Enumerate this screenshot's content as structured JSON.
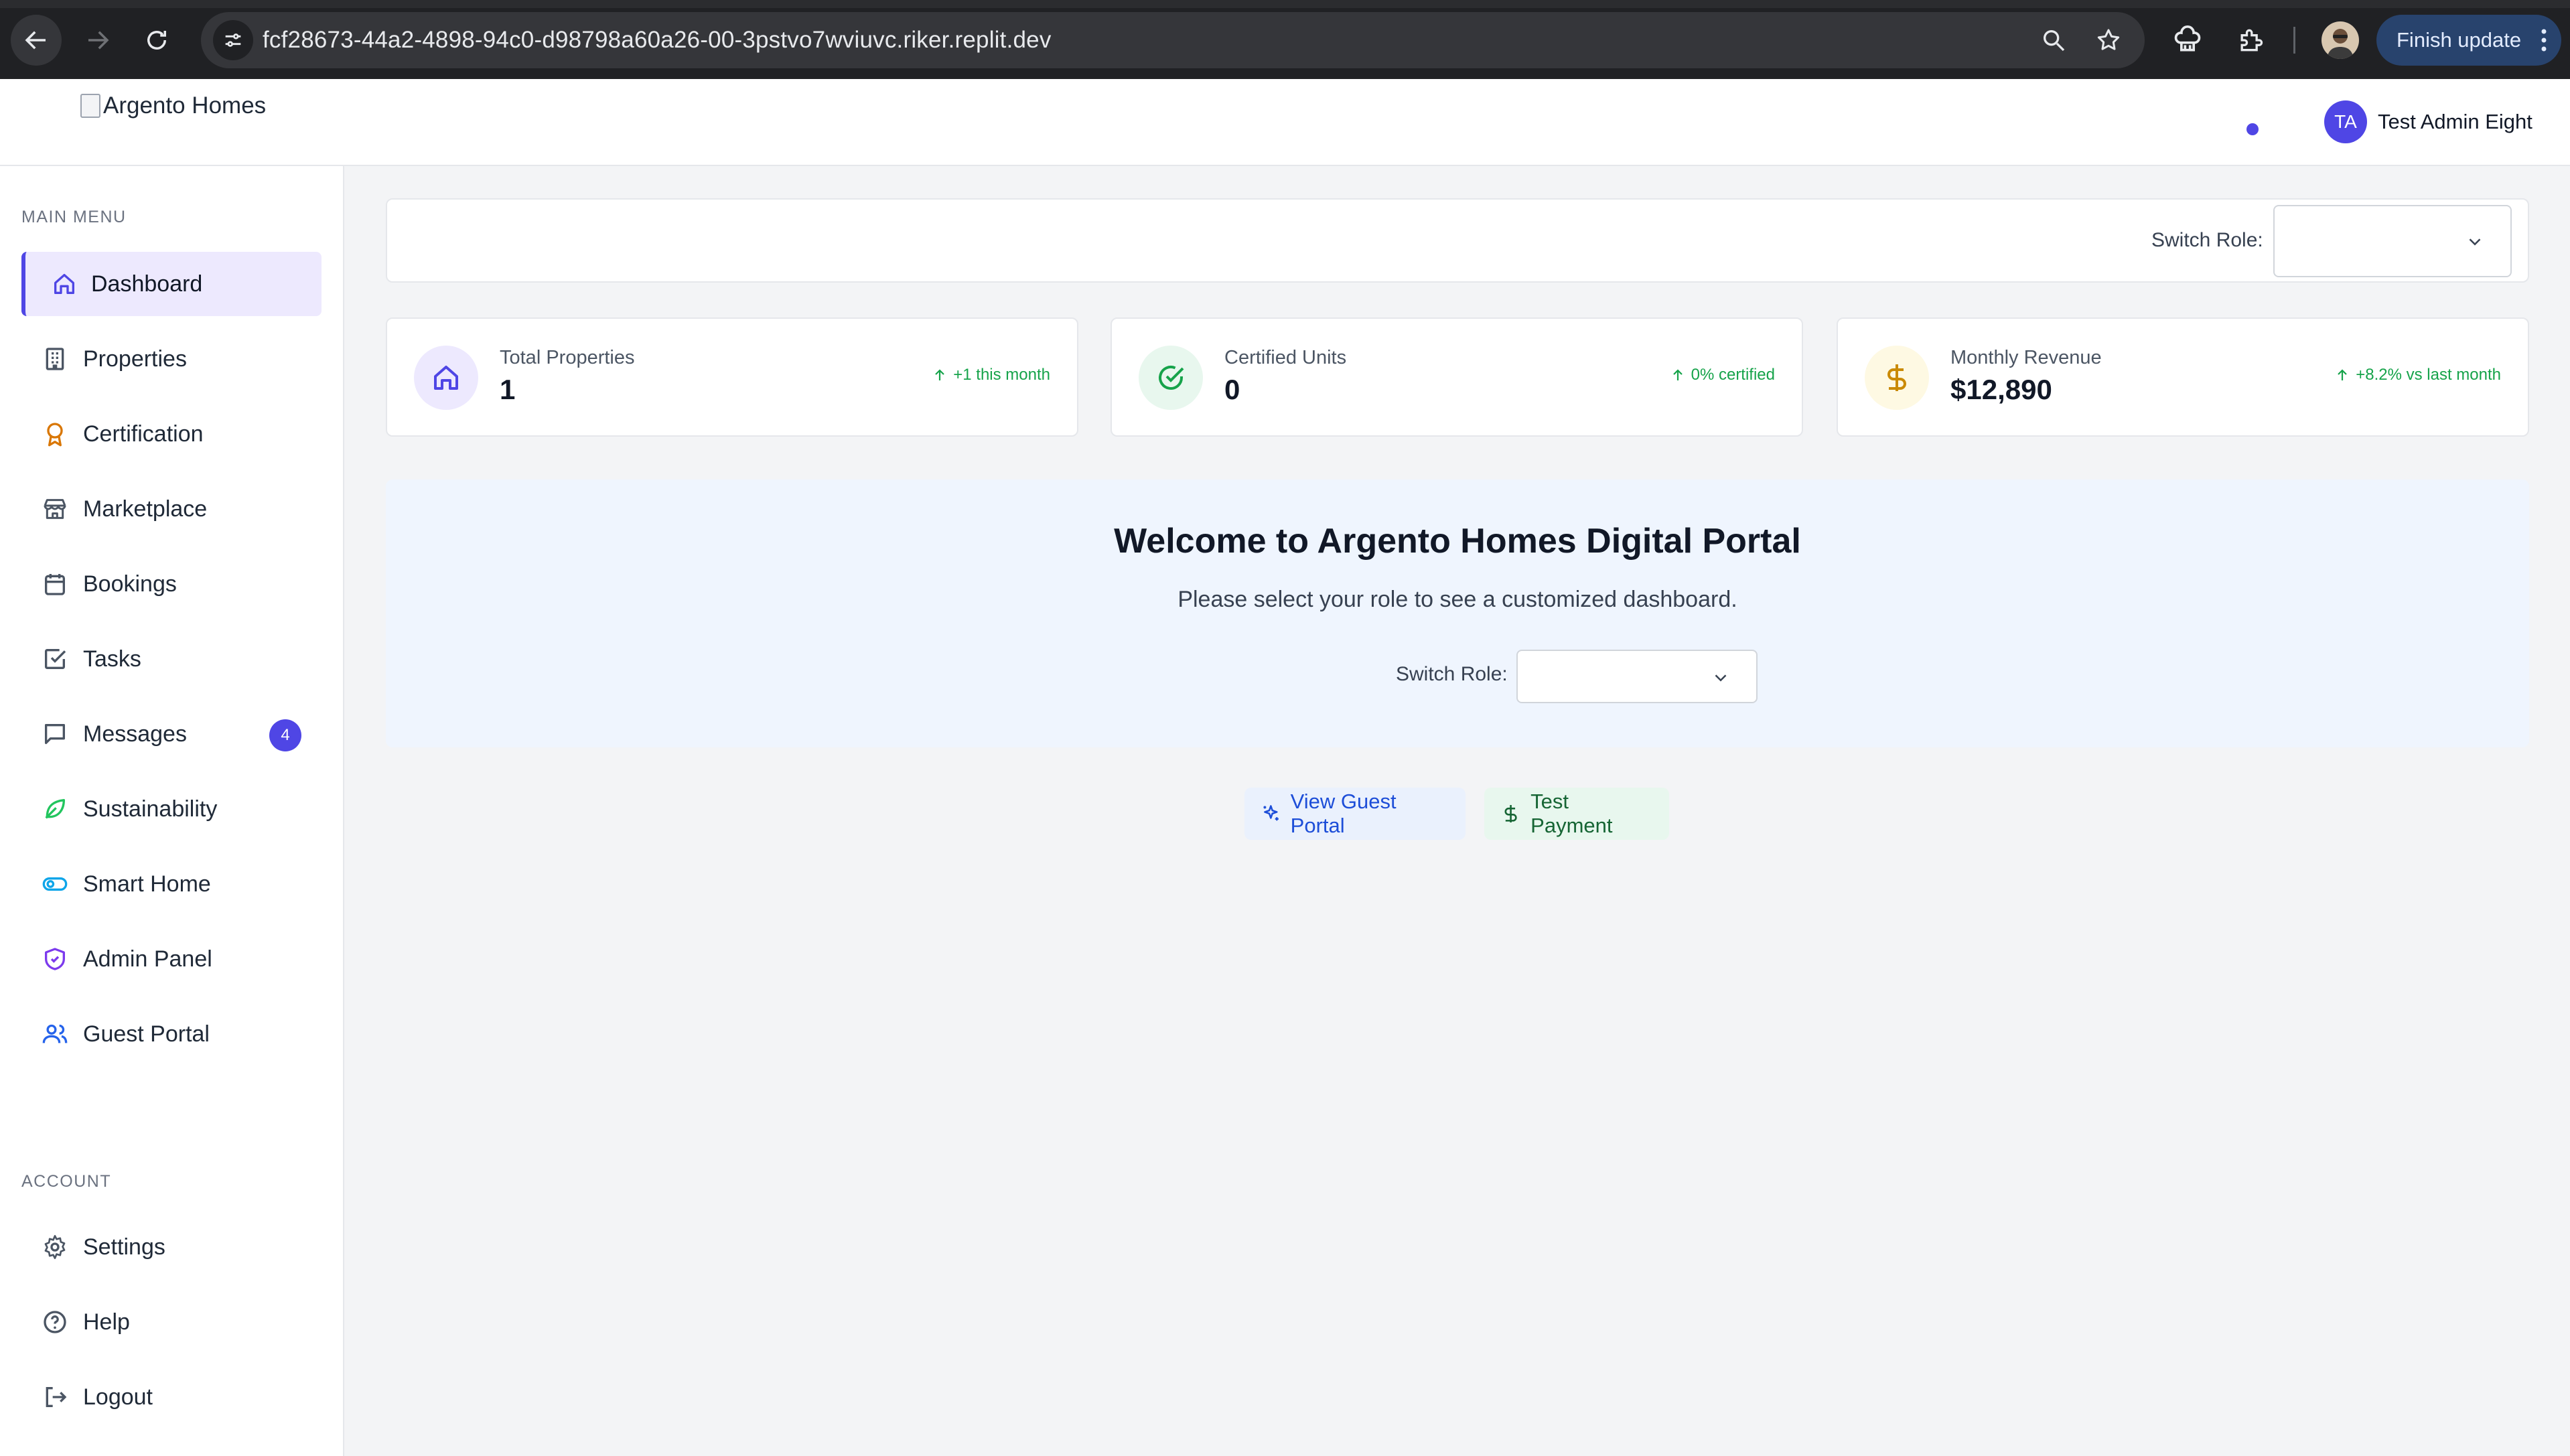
{
  "browser": {
    "url": "fcf28673-44a2-4898-94c0-d98798a60a26-00-3pstvo7wviuvc.riker.replit.dev",
    "finish_update_label": "Finish update"
  },
  "header": {
    "logo_alt": "Argento Homes",
    "user_initials": "TA",
    "user_name": "Test Admin Eight"
  },
  "sidebar": {
    "main_menu_label": "MAIN MENU",
    "items": [
      {
        "label": "Dashboard",
        "icon": "home-icon",
        "active": true
      },
      {
        "label": "Properties",
        "icon": "building-icon"
      },
      {
        "label": "Certification",
        "icon": "award-icon"
      },
      {
        "label": "Marketplace",
        "icon": "store-icon"
      },
      {
        "label": "Bookings",
        "icon": "calendar-icon"
      },
      {
        "label": "Tasks",
        "icon": "check-square-icon"
      },
      {
        "label": "Messages",
        "icon": "message-icon",
        "badge": "4"
      },
      {
        "label": "Sustainability",
        "icon": "leaf-icon"
      },
      {
        "label": "Smart Home",
        "icon": "toggle-icon"
      },
      {
        "label": "Admin Panel",
        "icon": "shield-icon"
      },
      {
        "label": "Guest Portal",
        "icon": "users-icon"
      }
    ],
    "account_label": "ACCOUNT",
    "account_items": [
      {
        "label": "Settings",
        "icon": "gear-icon"
      },
      {
        "label": "Help",
        "icon": "help-circle-icon"
      },
      {
        "label": "Logout",
        "icon": "logout-icon"
      }
    ]
  },
  "role_bar": {
    "label": "Switch Role:",
    "selected": ""
  },
  "stats": [
    {
      "title": "Total Properties",
      "value": "1",
      "trend": "+1 this month",
      "icon": "home-icon",
      "color": "#4f46e5",
      "bg": "#ede9fe"
    },
    {
      "title": "Certified Units",
      "value": "0",
      "trend": "0% certified",
      "icon": "check-circle-icon",
      "color": "#16a34a",
      "bg": "#e8f7ee"
    },
    {
      "title": "Monthly Revenue",
      "value": "$12,890",
      "trend": "+8.2% vs last month",
      "icon": "dollar-icon",
      "color": "#ca8a04",
      "bg": "#fef9e3"
    }
  ],
  "welcome": {
    "title": "Welcome to Argento Homes Digital Portal",
    "subtitle": "Please select your role to see a customized dashboard.",
    "switch_label": "Switch Role:",
    "selected": ""
  },
  "actions": {
    "guest_portal": "View Guest Portal",
    "test_payment": "Test Payment"
  },
  "colors": {
    "accent": "#4f46e5",
    "trend_green": "#16a34a"
  }
}
